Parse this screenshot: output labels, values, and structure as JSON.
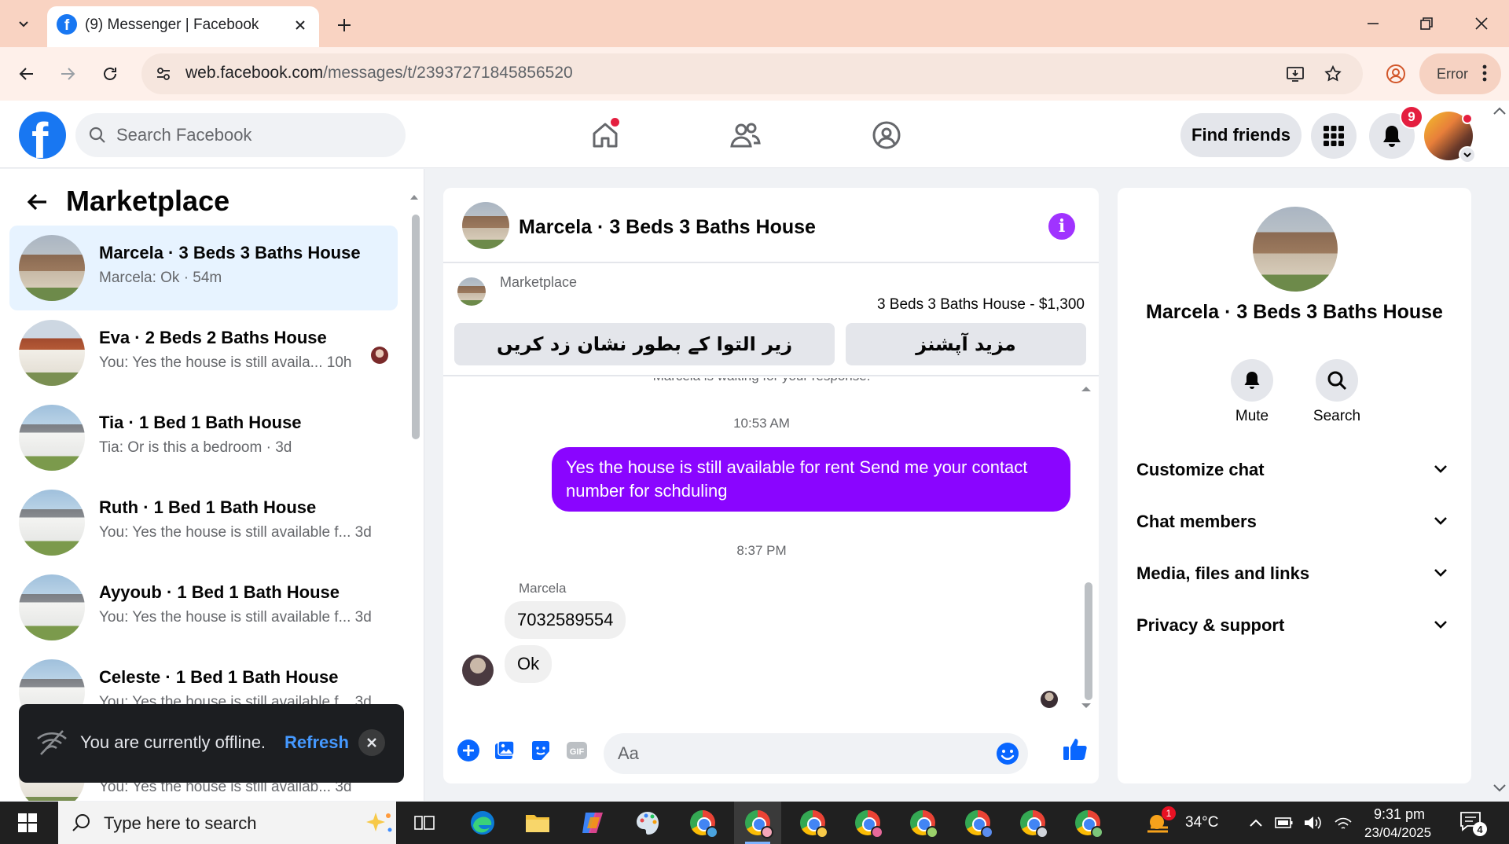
{
  "browser": {
    "tab_title": "(9) Messenger | Facebook",
    "url_host": "web.facebook.com",
    "url_path": "/messages/t/23937271845856520",
    "profile_status": "Error"
  },
  "fb_header": {
    "search_placeholder": "Search Facebook",
    "find_friends": "Find friends",
    "notification_count": "9"
  },
  "left_panel": {
    "title": "Marketplace",
    "conversations": [
      {
        "name": "Marcela · 3 Beds 3 Baths House",
        "snippet": "Marcela: Ok · 54m",
        "thumb": "house-a",
        "active": true
      },
      {
        "name": "Eva · 2 Beds 2 Baths House",
        "snippet": "You: Yes the house is still availa...  10h",
        "thumb": "house-b"
      },
      {
        "name": "Tia · 1 Bed 1 Bath House",
        "snippet": "Tia: Or is this a bedroom · 3d",
        "thumb": "house-c"
      },
      {
        "name": "Ruth · 1 Bed 1 Bath House",
        "snippet": "You: Yes the house is still available f...  3d",
        "thumb": "house-c"
      },
      {
        "name": "Ayyoub · 1 Bed 1 Bath House",
        "snippet": "You: Yes the house is still available f...  3d",
        "thumb": "house-c"
      },
      {
        "name": "Celeste · 1 Bed 1 Bath House",
        "snippet": "You: Yes the house is still available f...  3d",
        "thumb": "house-c"
      },
      {
        "name": "",
        "snippet": "You: Yes the house is still availab...  3d",
        "thumb": "house-b"
      }
    ]
  },
  "chat": {
    "title": "Marcela · 3 Beds 3 Baths House",
    "marketplace_label": "Marketplace",
    "listing_price": "3 Beds 3 Baths House - $1,300",
    "mark_pending_button": "زیر التوا کے بطور نشان زد کریں",
    "more_options_button": "مزید آپشنز",
    "waiting_notice": "Marcela is waiting for your response.",
    "time_1": "10:53 AM",
    "outgoing_message": "Yes the house is still available for rent Send me your contact number for schduling",
    "time_2": "8:37 PM",
    "sender_name": "Marcela",
    "incoming_message_1": "7032589554",
    "incoming_message_2": "Ok",
    "composer_placeholder": "Aa"
  },
  "right_panel": {
    "name": "Marcela · 3 Beds 3 Baths House",
    "mute_label": "Mute",
    "search_label": "Search",
    "sections": [
      "Customize chat",
      "Chat members",
      "Media, files and links",
      "Privacy & support"
    ]
  },
  "toast": {
    "message": "You are currently offline.",
    "action": "Refresh"
  },
  "taskbar": {
    "search_placeholder": "Type here to search",
    "temperature": "34°C",
    "weather_badge": "1",
    "time": "9:31 pm",
    "date": "23/04/2025",
    "notification_count": "4"
  },
  "colors": {
    "facebook_blue": "#1877f2",
    "messenger_purple": "#8a05ff",
    "notification_red": "#e41e3f",
    "active_conversation": "#e7f3ff"
  }
}
